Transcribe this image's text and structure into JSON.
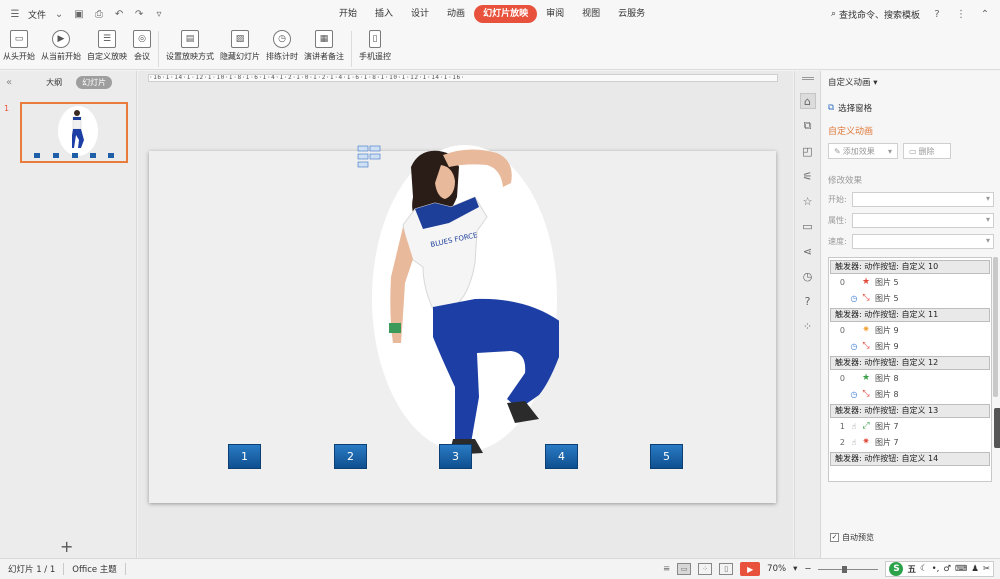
{
  "menubar": {
    "file_label": "文件",
    "tabs": [
      "开始",
      "插入",
      "设计",
      "动画",
      "幻灯片放映",
      "审阅",
      "视图",
      "云服务"
    ],
    "active_tab": "幻灯片放映",
    "search_label": "查找命令、搜索模板"
  },
  "ribbon": {
    "buttons": [
      {
        "label": "从头开始",
        "icon": "play-from-start-icon"
      },
      {
        "label": "从当前开始",
        "icon": "play-from-current-icon"
      },
      {
        "label": "自定义放映",
        "icon": "custom-show-icon"
      },
      {
        "label": "会议",
        "icon": "meeting-icon"
      },
      {
        "label": "设置放映方式",
        "icon": "setup-show-icon"
      },
      {
        "label": "隐藏幻灯片",
        "icon": "hide-slide-icon"
      },
      {
        "label": "排练计时",
        "icon": "rehearse-timer-icon"
      },
      {
        "label": "演讲者备注",
        "icon": "speaker-notes-icon"
      },
      {
        "label": "手机遥控",
        "icon": "phone-remote-icon"
      }
    ]
  },
  "leftpane": {
    "view_tabs": [
      "大纲",
      "幻灯片"
    ],
    "active_view": "幻灯片",
    "slide_number": "1"
  },
  "ruler": {
    "text": "·16·I·14·I·12·I·10·I·8·I·6·I·4·I·2·I·0·I·2·I·4·I·6·I·8·I·10·I·12·I·14·I·16·"
  },
  "slide": {
    "buttons": [
      "1",
      "2",
      "3",
      "4",
      "5"
    ]
  },
  "rightpanel": {
    "title": "自定义动画",
    "select_pane": "选择窗格",
    "section_title": "自定义动画",
    "add_effect": "添加效果",
    "delete": "删除",
    "modify_title": "修改效果",
    "start_label": "开始:",
    "property_label": "属性:",
    "speed_label": "速度:",
    "triggers": [
      {
        "label": "触发器: 动作按钮: 自定义 10",
        "effects": [
          {
            "num": "0",
            "timer": false,
            "star": "red",
            "label": "图片 5"
          },
          {
            "num": "",
            "timer": true,
            "star": "red-exit",
            "label": "图片 5"
          }
        ]
      },
      {
        "label": "触发器: 动作按钮: 自定义 11",
        "effects": [
          {
            "num": "0",
            "timer": false,
            "star": "orange",
            "label": "图片 9"
          },
          {
            "num": "",
            "timer": true,
            "star": "red-exit",
            "label": "图片 9"
          }
        ]
      },
      {
        "label": "触发器: 动作按钮: 自定义 12",
        "effects": [
          {
            "num": "0",
            "timer": false,
            "star": "green",
            "label": "图片 8"
          },
          {
            "num": "",
            "timer": true,
            "star": "red-exit",
            "label": "图片 8"
          }
        ]
      },
      {
        "label": "触发器: 动作按钮: 自定义 13",
        "effects": [
          {
            "num": "1",
            "timer": false,
            "star": "green",
            "label": "图片 7"
          },
          {
            "num": "2",
            "timer": false,
            "star": "red",
            "label": "图片 7"
          }
        ]
      },
      {
        "label": "触发器: 动作按钮: 自定义 14",
        "effects": []
      }
    ],
    "auto_preview": "自动预览"
  },
  "statusbar": {
    "slide_counter": "幻灯片 1 / 1",
    "theme": "Office 主题",
    "zoom": "70%",
    "ime_label": "五"
  }
}
